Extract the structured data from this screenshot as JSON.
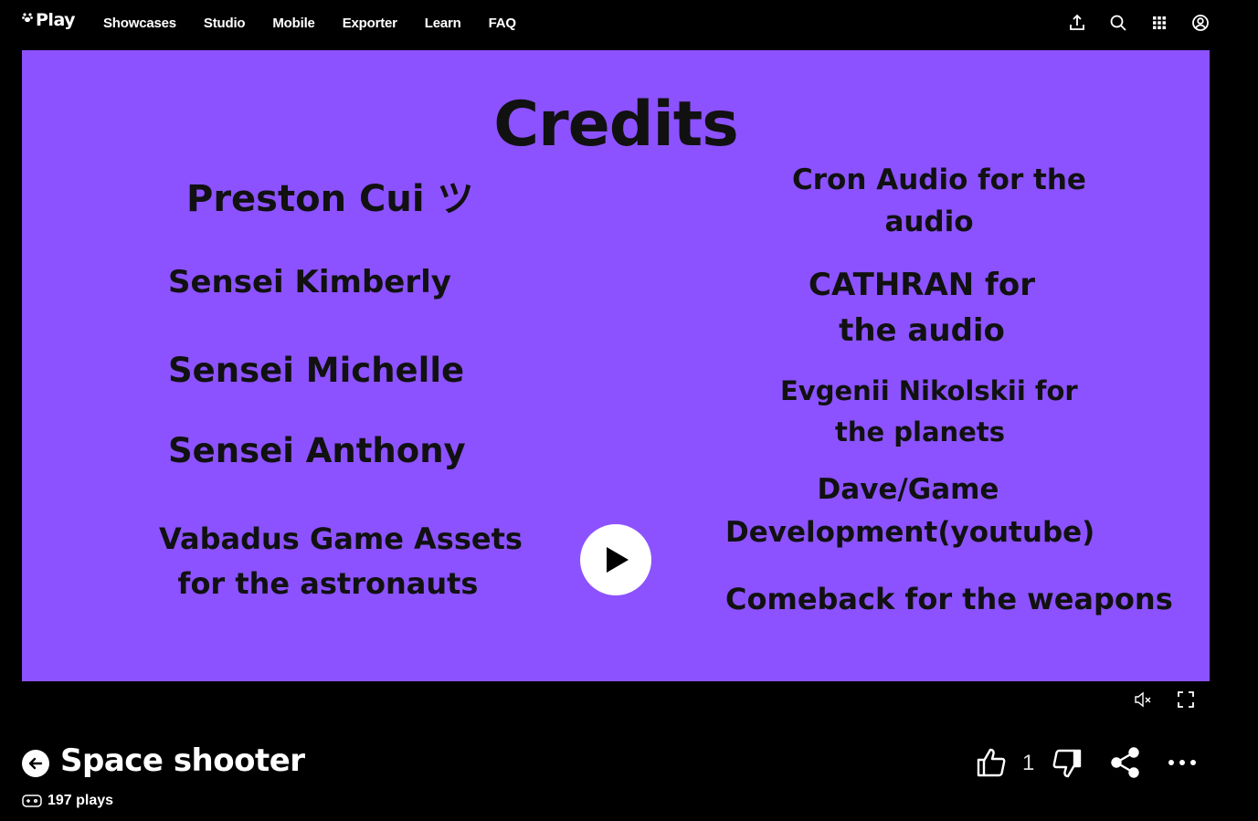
{
  "app": {
    "logo_text": "Play",
    "logo_icon": "paw-icon"
  },
  "nav": {
    "items": [
      {
        "label": "Showcases"
      },
      {
        "label": "Studio"
      },
      {
        "label": "Mobile"
      },
      {
        "label": "Exporter"
      },
      {
        "label": "Learn"
      },
      {
        "label": "FAQ"
      }
    ],
    "icons": [
      "upload-icon",
      "search-icon",
      "apps-grid-icon",
      "account-icon"
    ]
  },
  "stage": {
    "background": "#8c52ff",
    "title": "Credits",
    "left_credits": [
      {
        "lines": [
          "Preston Cui ツ"
        ]
      },
      {
        "lines": [
          "Sensei Kimberly"
        ]
      },
      {
        "lines": [
          "Sensei Michelle"
        ]
      },
      {
        "lines": [
          "Sensei Anthony"
        ]
      },
      {
        "lines": [
          "Vabadus Game Assets",
          "for the astronauts"
        ]
      }
    ],
    "right_credits": [
      {
        "lines": [
          "Cron Audio for the",
          "audio"
        ]
      },
      {
        "lines": [
          "CATHRAN for",
          "the audio"
        ]
      },
      {
        "lines": [
          "Evgenii Nikolskii for",
          "the planets"
        ]
      },
      {
        "lines": [
          "Dave/Game",
          "Development(youtube)"
        ]
      },
      {
        "lines": [
          "Comeback for the weapons"
        ]
      }
    ],
    "play_icon": "play-icon"
  },
  "controls": {
    "mute_icon": "mute-icon",
    "fullscreen_icon": "fullscreen-icon"
  },
  "game": {
    "title": "Space shooter",
    "plays": "197 plays",
    "likes": "1"
  }
}
